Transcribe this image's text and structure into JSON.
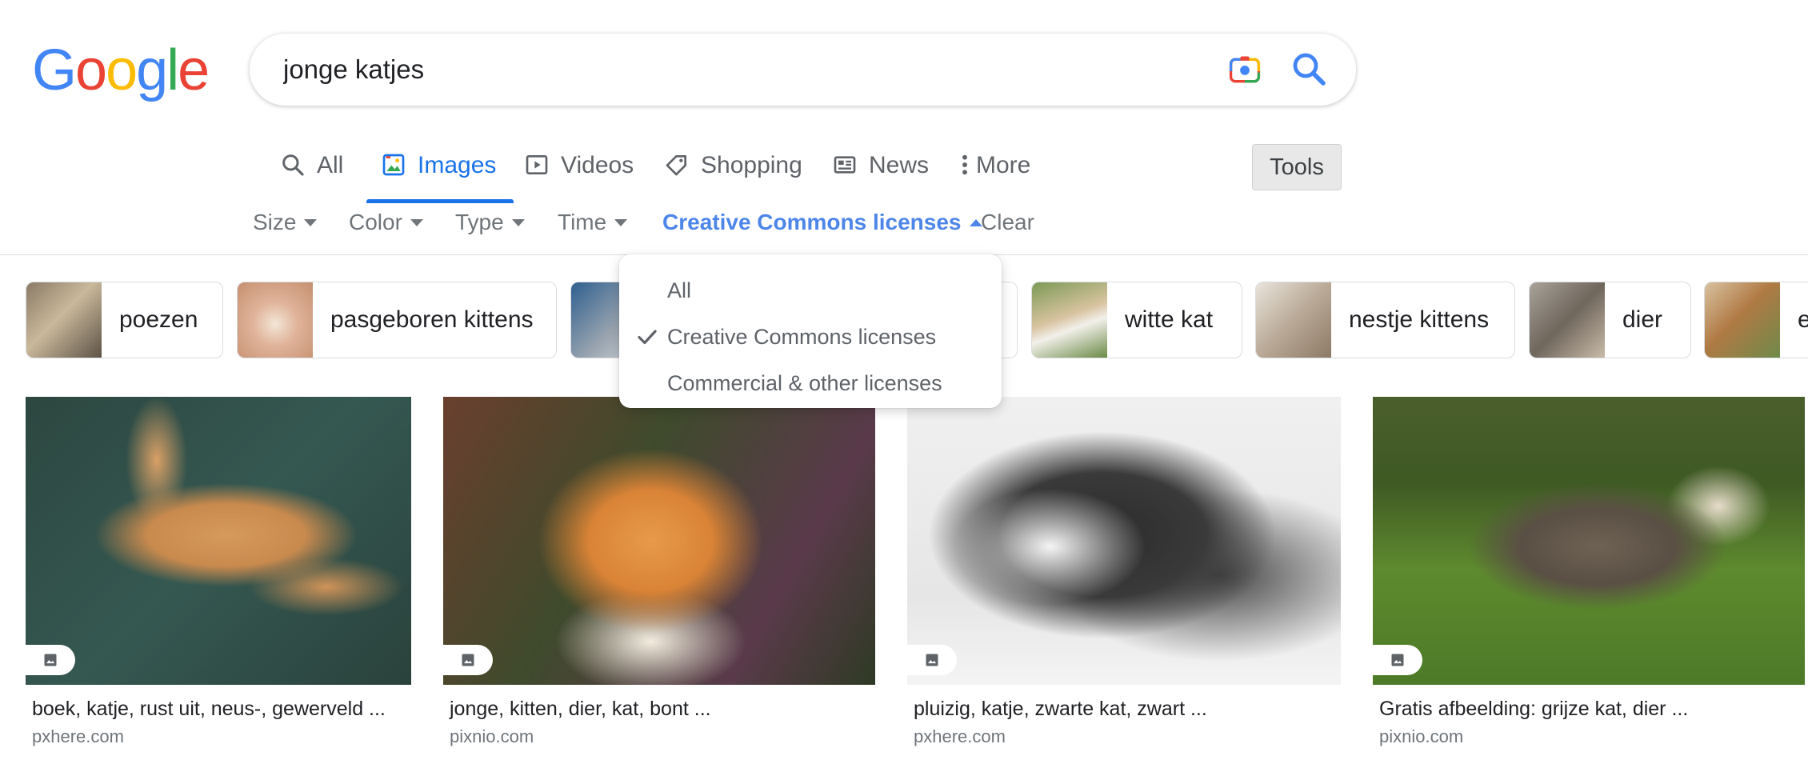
{
  "search": {
    "query": "jonge katjes"
  },
  "tabs": [
    {
      "label": "All"
    },
    {
      "label": "Images"
    },
    {
      "label": "Videos"
    },
    {
      "label": "Shopping"
    },
    {
      "label": "News"
    },
    {
      "label": "More"
    }
  ],
  "tools_label": "Tools",
  "filters": {
    "size": "Size",
    "color": "Color",
    "type": "Type",
    "time": "Time",
    "license": "Creative Commons licenses",
    "clear": "Clear"
  },
  "license_menu": {
    "options": [
      "All",
      "Creative Commons licenses",
      "Commercial & other licenses"
    ],
    "selected": "Creative Commons licenses"
  },
  "chips": [
    "poezen",
    "pasgeboren kittens",
    "witte kat",
    "nestje kittens",
    "dier",
    "e"
  ],
  "results": [
    {
      "title": "boek, katje, rust uit, neus-, gewerveld ...",
      "source": "pxhere.com"
    },
    {
      "title": "jonge, kitten, dier, kat, bont ...",
      "source": "pixnio.com"
    },
    {
      "title": "pluizig, katje, zwarte kat, zwart ...",
      "source": "pxhere.com"
    },
    {
      "title": "Gratis afbeelding: grijze kat, dier ...",
      "source": "pixnio.com"
    }
  ],
  "colors": {
    "accent": "#1a73e8",
    "logo_blue": "#4285f4",
    "logo_red": "#ea4335",
    "logo_yellow": "#fbbc05",
    "logo_green": "#34a853"
  },
  "icons": [
    "camera-icon",
    "search-icon",
    "image-icon",
    "video-icon",
    "tag-icon",
    "news-icon",
    "more-dots-icon",
    "check-icon"
  ]
}
